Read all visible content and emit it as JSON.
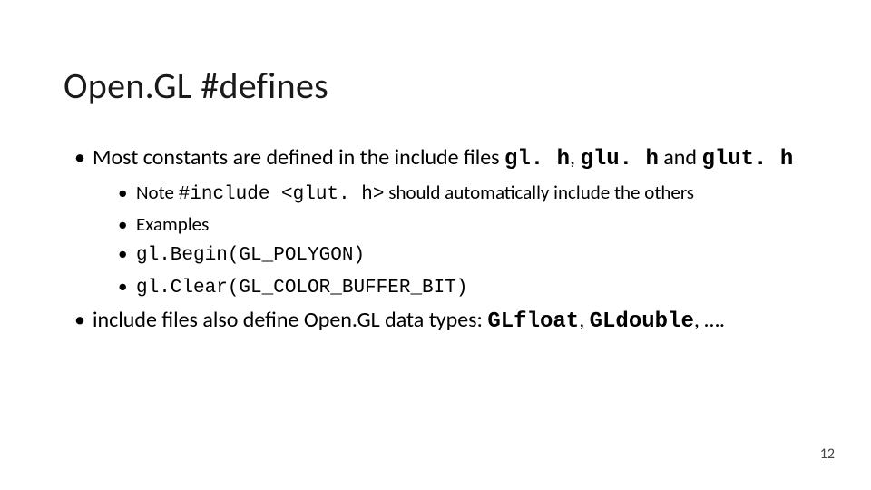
{
  "title": "Open.GL #defines",
  "bullets": {
    "b1_pre": "Most constants are defined in the include files ",
    "b1_code1": "gl. h",
    "b1_sep1": ", ",
    "b1_code2": "glu. h",
    "b1_mid": " and ",
    "b1_code3": "glut. h",
    "sub1_a": "Note ",
    "sub1_code": "#include <glut. h>",
    "sub1_b": " should automatically include the others",
    "sub2": "Examples",
    "sub3": "gl.Begin(GL_POLYGON)",
    "sub4": "gl.Clear(GL_COLOR_BUFFER_BIT)",
    "b2_pre": "include files also define Open.GL data types: ",
    "b2_code1": "GLfloat",
    "b2_sep": ", ",
    "b2_code2": "GLdouble",
    "b2_end": ", …."
  },
  "page_number": "12"
}
